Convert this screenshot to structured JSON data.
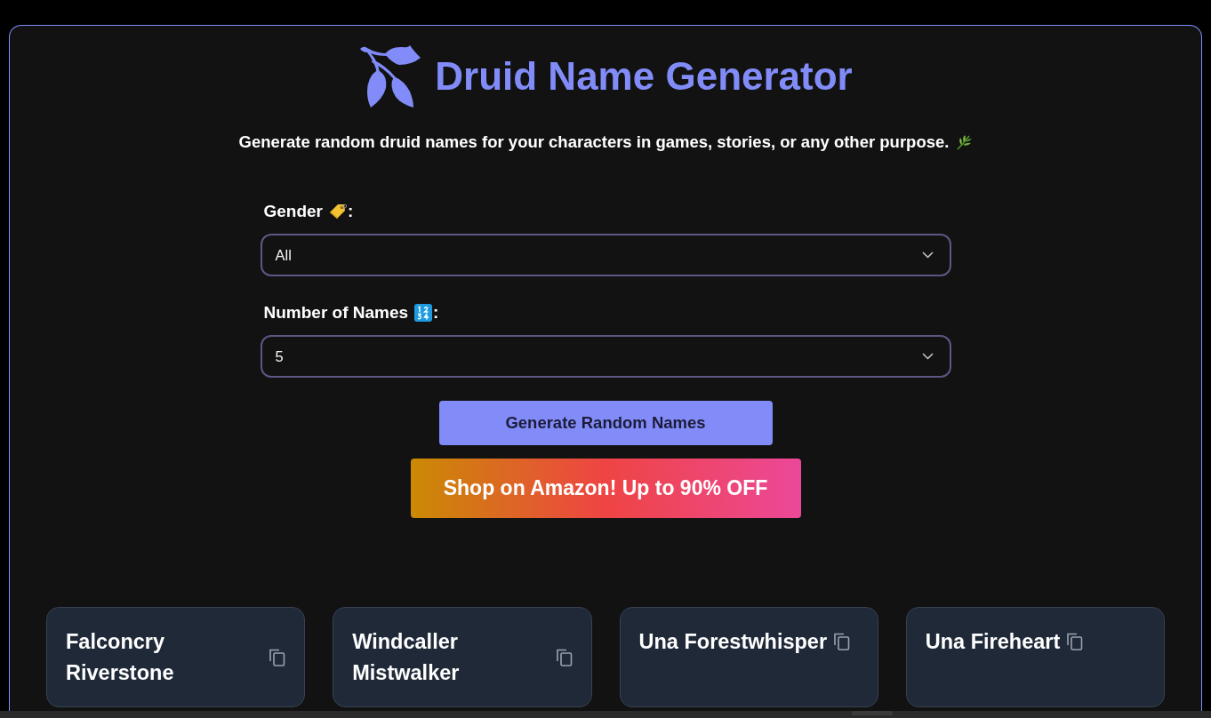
{
  "header": {
    "title": "Druid Name Generator",
    "subtitle": "Generate random druid names for your characters in games, stories, or any other purpose."
  },
  "form": {
    "fields": [
      {
        "label": "Gender",
        "label_end": ":",
        "value": "All"
      },
      {
        "label": "Number of Names",
        "label_end": ":",
        "value": "5"
      }
    ]
  },
  "buttons": [
    {
      "label": "Generate Random Names",
      "kind": "primary"
    },
    {
      "label": "Shop on Amazon! Up to 90% OFF",
      "kind": "promo"
    }
  ],
  "results": [
    {
      "name": "Falconcry Riverstone"
    },
    {
      "name": "Windcaller Mistwalker"
    },
    {
      "name": "Una Forestwhisper"
    },
    {
      "name": "Una Fireheart"
    }
  ]
}
